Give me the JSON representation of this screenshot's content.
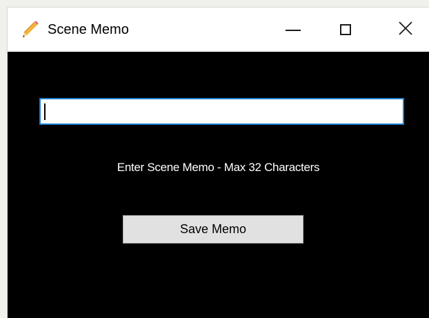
{
  "window": {
    "title": "Scene Memo",
    "icon": "pencil-icon",
    "controls": {
      "minimize_icon": "minimize-icon",
      "maximize_icon": "maximize-icon",
      "close_icon": "close-icon"
    }
  },
  "form": {
    "memo_value": "",
    "instruction": "Enter Scene Memo - Max 32 Characters",
    "save_label": "Save Memo"
  },
  "colors": {
    "window_background": "#000000",
    "titlebar_background": "#ffffff",
    "input_focus_border": "#1f7fd0",
    "button_background": "#e1e1e1",
    "button_border": "#adadad",
    "instruction_text": "#ffffff"
  }
}
